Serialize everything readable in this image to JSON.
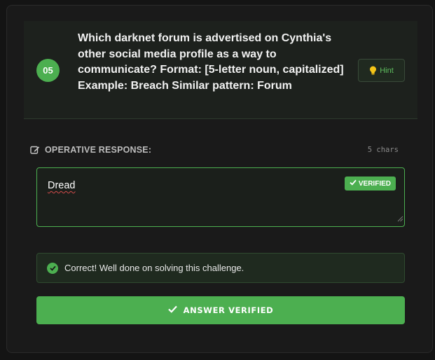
{
  "question": {
    "number": "05",
    "text": "Which darknet forum is advertised on Cynthia's other social media profile as a way to communicate? Format: [5-letter noun, capitalized] Example: Breach Similar pattern: Forum",
    "hint_label": "Hint",
    "hint_icon": "lightbulb-icon"
  },
  "response": {
    "label": "OPERATIVE RESPONSE:",
    "label_icon": "edit-icon",
    "char_count": "5 chars",
    "value": "Dread",
    "status_badge": "VERIFIED"
  },
  "feedback": {
    "message": "Correct! Well done on solving this challenge.",
    "icon": "check-circle-icon"
  },
  "submit": {
    "label": "ANSWER VERIFIED",
    "icon": "check-icon"
  },
  "colors": {
    "accent": "#4caf50",
    "background": "#141414",
    "card": "#1a1a1a"
  }
}
